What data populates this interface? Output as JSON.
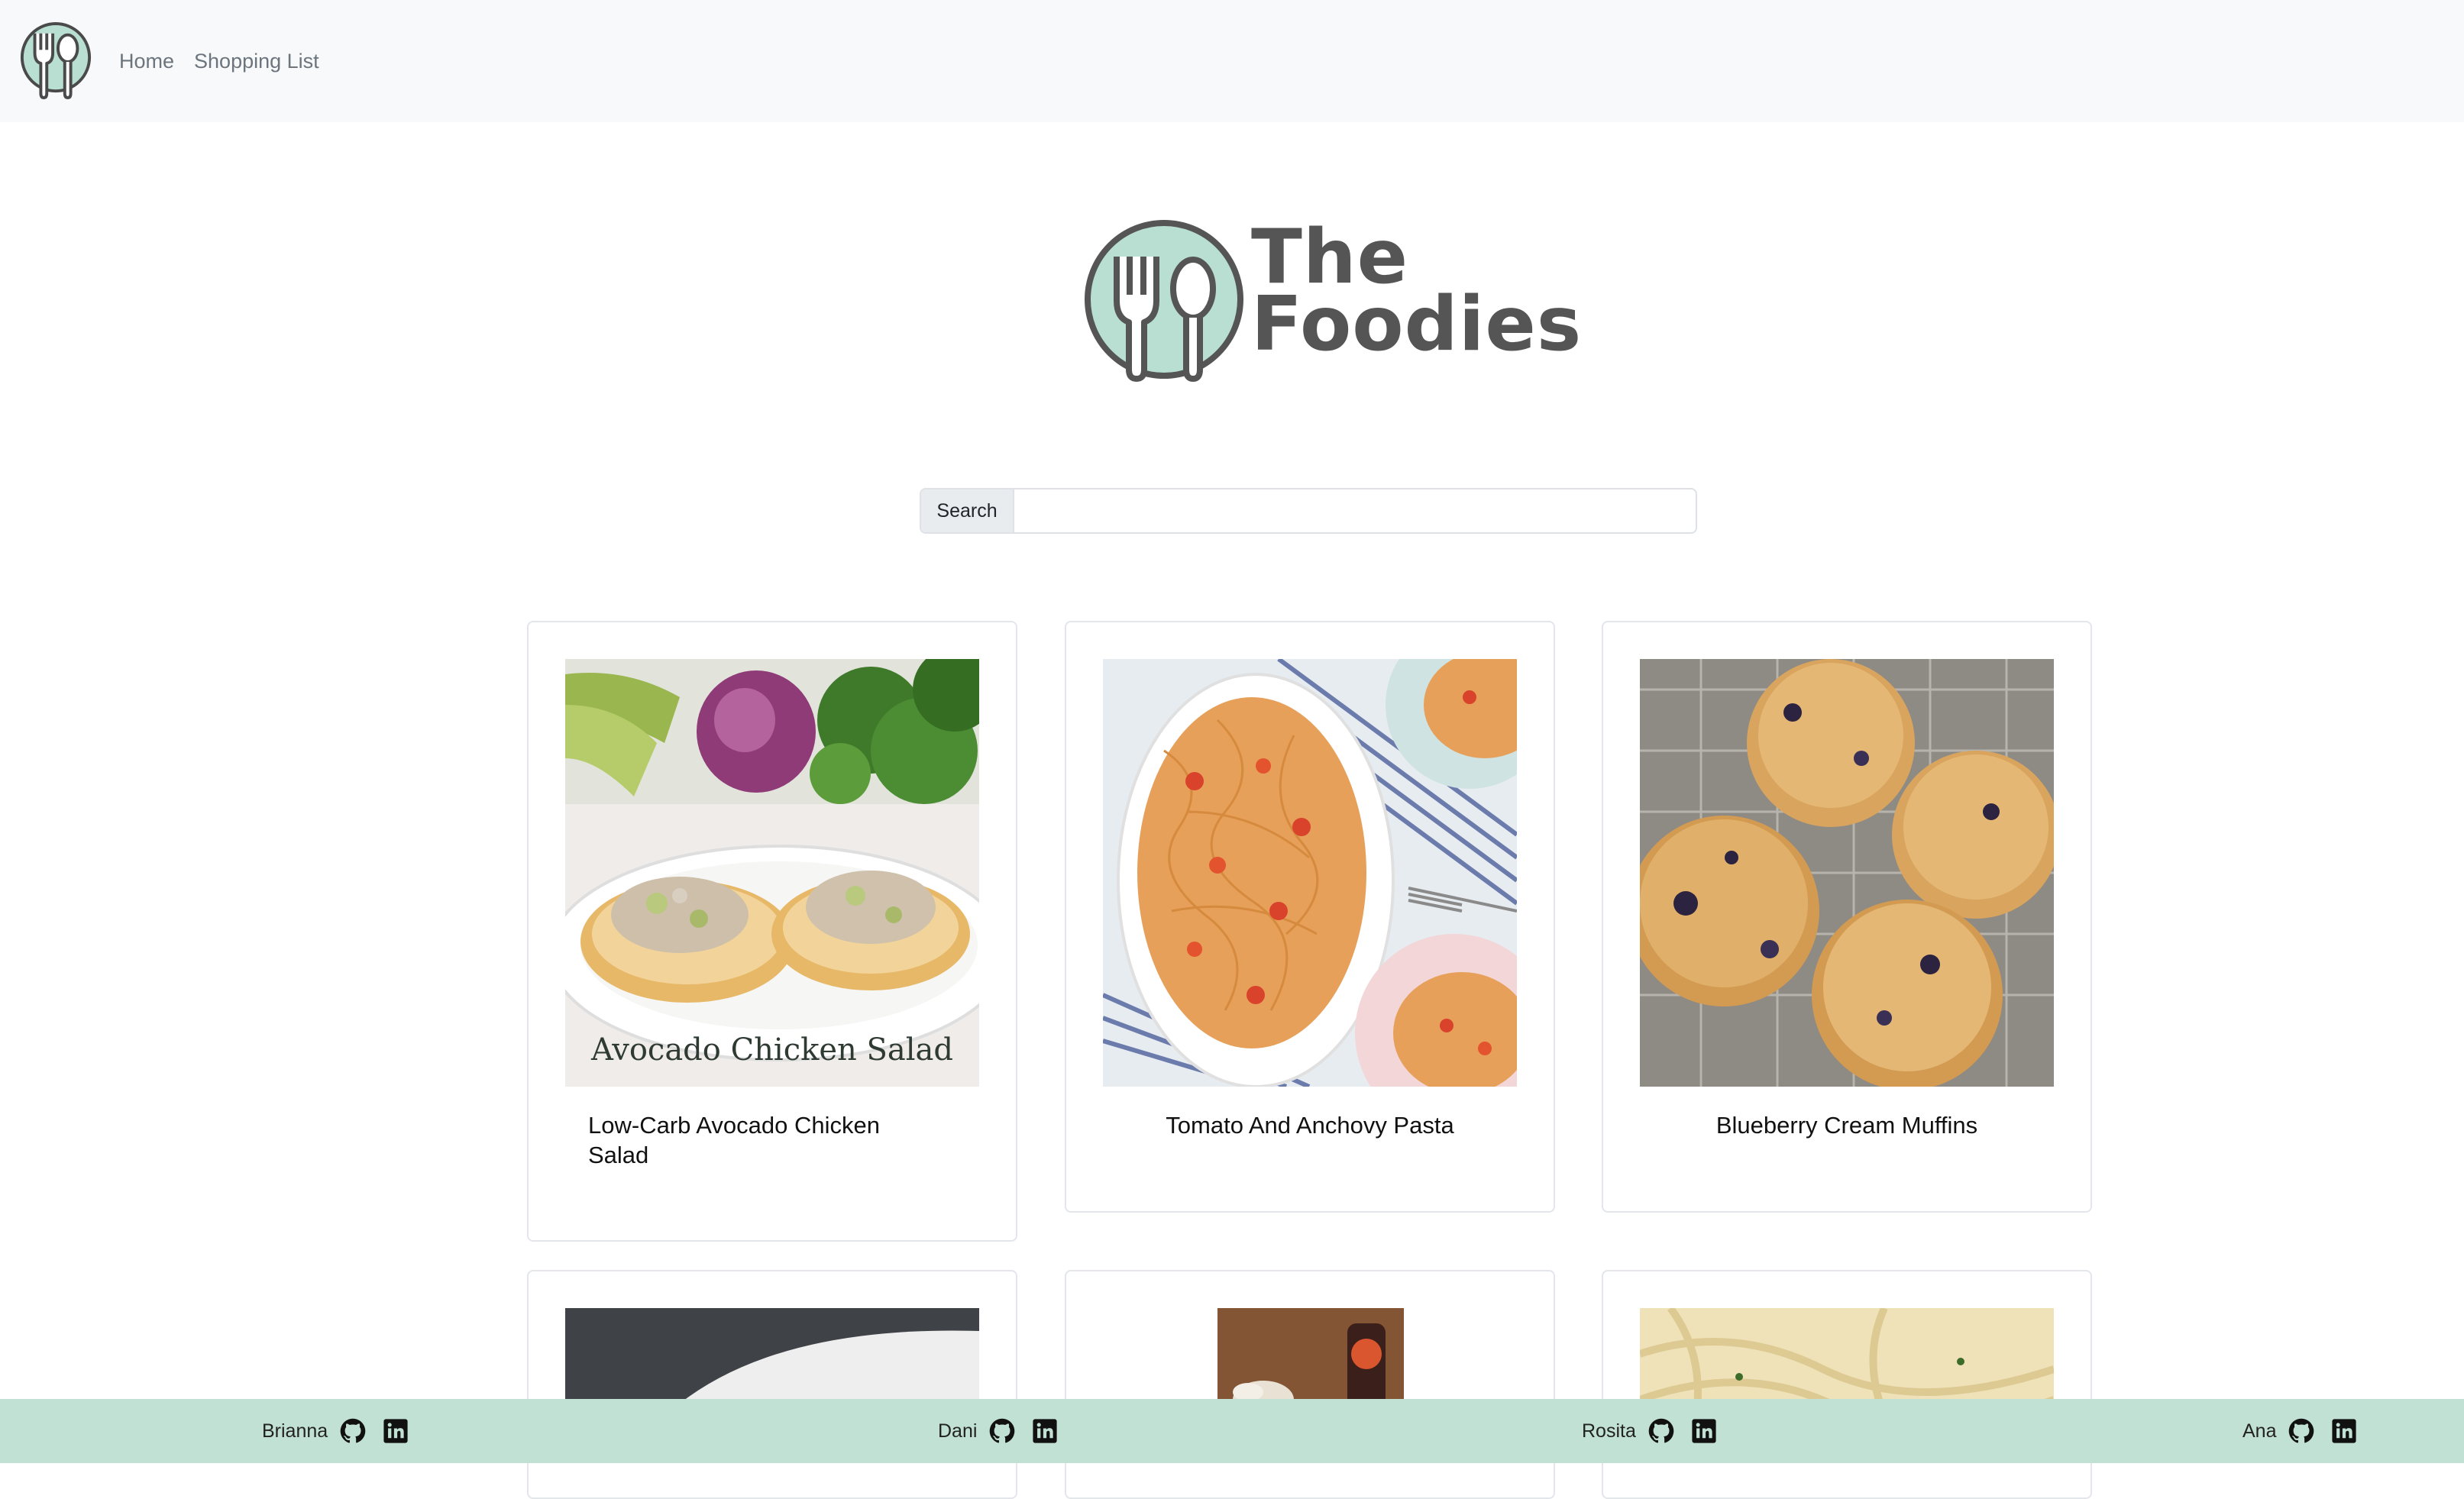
{
  "nav": {
    "logo_icon": "fork-spoon-plate-icon",
    "links": [
      "Home",
      "Shopping List"
    ]
  },
  "hero": {
    "brand_line1": "The",
    "brand_line2": "Foodies",
    "accent_color": "#b9dfd2",
    "text_color": "#555555"
  },
  "search": {
    "label": "Search",
    "value": "",
    "placeholder": ""
  },
  "recipes": [
    {
      "title": "Low-Carb Avocado Chicken Salad",
      "image_caption": "Avocado Chicken Salad"
    },
    {
      "title": "Tomato And Anchovy Pasta"
    },
    {
      "title": "Blueberry Cream Muffins"
    },
    {
      "title": ""
    },
    {
      "title": ""
    },
    {
      "title": ""
    }
  ],
  "footer": {
    "background": "#c1e1d5",
    "members": [
      {
        "name": "Brianna",
        "icons": [
          "github-icon",
          "linkedin-icon"
        ]
      },
      {
        "name": "Dani",
        "icons": [
          "github-icon",
          "linkedin-icon"
        ]
      },
      {
        "name": "Rosita",
        "icons": [
          "github-icon",
          "linkedin-icon"
        ]
      },
      {
        "name": "Ana",
        "icons": [
          "github-icon",
          "linkedin-icon"
        ]
      }
    ]
  }
}
